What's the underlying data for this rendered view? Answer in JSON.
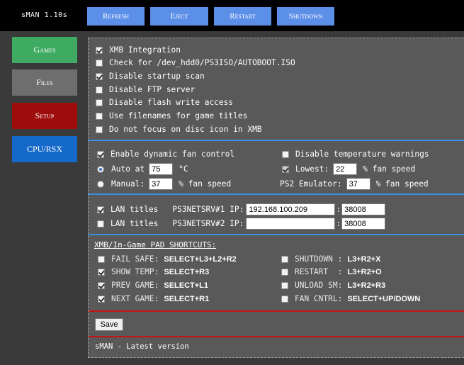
{
  "app": {
    "brand": "sMAN 1.10s"
  },
  "topbar": {
    "refresh": "Refresh",
    "eject": "Eject",
    "restart": "Restart",
    "shutdown": "Shutdown"
  },
  "sidebar": {
    "games": "Games",
    "files": "Files",
    "setup": "Setup",
    "cpu": "CPU/RSX"
  },
  "colors": {
    "accent_blue": "#5b8fe8",
    "games_green": "#3faa62",
    "setup_red": "#9e0c0c",
    "cpu_blue": "#1569c9",
    "files_gray": "#6e6e6e"
  },
  "general": [
    {
      "label": "XMB Integration",
      "checked": true
    },
    {
      "label": "Check for /dev_hdd0/PS3ISO/AUTOBOOT.ISO",
      "checked": false
    },
    {
      "label": "Disable startup scan",
      "checked": true
    },
    {
      "label": "Disable FTP server",
      "checked": false
    },
    {
      "label": "Disable flash write access",
      "checked": false
    },
    {
      "label": "Use filenames for game titles",
      "checked": false
    },
    {
      "label": "Do not focus on disc icon in XMB",
      "checked": false
    }
  ],
  "fan": {
    "dynamic_label": "Enable dynamic fan control",
    "dynamic_checked": true,
    "auto_label": "Auto at",
    "auto_value": "75",
    "auto_unit": "°C",
    "manual_label": "Manual:",
    "manual_value": "37",
    "manual_unit": "% fan speed",
    "disable_temp_label": "Disable temperature warnings",
    "lowest_label": "Lowest:",
    "lowest_value": "22",
    "lowest_unit": "% fan speed",
    "ps2_label": "PS2 Emulator:",
    "ps2_value": "37",
    "ps2_unit": "% fan speed"
  },
  "lan": [
    {
      "label": "LAN titles",
      "server": "PS3NETSRV#1 IP:",
      "ip": "192.168.100.209",
      "port": "38008",
      "checked": true
    },
    {
      "label": "LAN titles",
      "server": "PS3NETSRV#2 IP:",
      "ip": "",
      "port": "38008",
      "checked": false
    }
  ],
  "shortcuts": {
    "title": "XMB/In-Game PAD SHORTCUTS:",
    "left": [
      {
        "label": "FAIL SAFE:",
        "combo": "SELECT+L3+L2+R2",
        "checked": false
      },
      {
        "label": "SHOW TEMP:",
        "combo": "SELECT+R3",
        "checked": true
      },
      {
        "label": "PREV GAME:",
        "combo": "SELECT+L1",
        "checked": true
      },
      {
        "label": "NEXT GAME:",
        "combo": "SELECT+R1",
        "checked": true
      }
    ],
    "right": [
      {
        "label": "SHUTDOWN :",
        "combo": "L3+R2+X",
        "checked": false
      },
      {
        "label": "RESTART  :",
        "combo": "L3+R2+O",
        "checked": false
      },
      {
        "label": "UNLOAD SM:",
        "combo": "L3+R2+R3",
        "checked": false
      },
      {
        "label": "FAN CNTRL:",
        "combo": "SELECT+UP/DOWN",
        "checked": false
      }
    ]
  },
  "save_label": "Save",
  "footer": "sMAN - Latest version"
}
